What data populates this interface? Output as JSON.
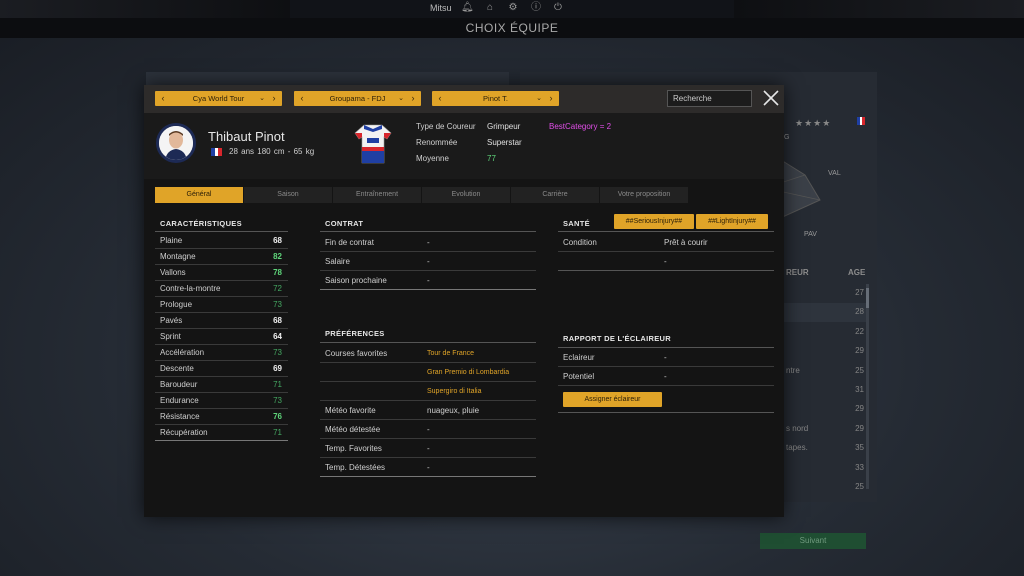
{
  "topbar": {
    "user": "Mitsu",
    "page_title": "CHOIX ÉQUIPE"
  },
  "background": {
    "stars": "★★★★",
    "radar_labels": [
      "G",
      "VAL",
      "PAV"
    ],
    "col_head": "REUR",
    "age_head": "AGE",
    "rows": [
      {
        "txt": "",
        "age": "27"
      },
      {
        "txt": "",
        "age": "28"
      },
      {
        "txt": "",
        "age": "22"
      },
      {
        "txt": "",
        "age": "29"
      },
      {
        "txt": "ntre",
        "age": "25"
      },
      {
        "txt": "",
        "age": "31"
      },
      {
        "txt": "",
        "age": "29"
      },
      {
        "txt": "s nord",
        "age": "29"
      },
      {
        "txt": "tapes.",
        "age": "35"
      },
      {
        "txt": "",
        "age": "33"
      },
      {
        "txt": "",
        "age": "25"
      }
    ],
    "next_button": "Suivant"
  },
  "filters": {
    "competition": "Cya World Tour",
    "team": "Groupama - FDJ",
    "rider": "Pinot T.",
    "search_placeholder": "Recherche"
  },
  "rider": {
    "name": "Thibaut Pinot",
    "info": "28 ans   180 cm - 65 kg",
    "type_label": "Type de Coureur",
    "type_value": "Grimpeur",
    "best_category": "BestCategory = 2",
    "renown_label": "Renommée",
    "renown_value": "Superstar",
    "average_label": "Moyenne",
    "average_value": "77"
  },
  "tabs": [
    "Général",
    "Saison",
    "Entraînement",
    "Evolution",
    "Carrière",
    "Votre proposition"
  ],
  "characteristics": {
    "title": "CARACTÉRISTIQUES",
    "items": [
      {
        "label": "Plaine",
        "value": "68"
      },
      {
        "label": "Montagne",
        "value": "82"
      },
      {
        "label": "Vallons",
        "value": "78"
      },
      {
        "label": "Contre-la-montre",
        "value": "72"
      },
      {
        "label": "Prologue",
        "value": "73"
      },
      {
        "label": "Pavés",
        "value": "68"
      },
      {
        "label": "Sprint",
        "value": "64"
      },
      {
        "label": "Accélération",
        "value": "73"
      },
      {
        "label": "Descente",
        "value": "69"
      },
      {
        "label": "Baroudeur",
        "value": "71"
      },
      {
        "label": "Endurance",
        "value": "73"
      },
      {
        "label": "Résistance",
        "value": "76"
      },
      {
        "label": "Récupération",
        "value": "71"
      }
    ]
  },
  "contract": {
    "title": "CONTRAT",
    "items": [
      {
        "label": "Fin de contrat",
        "value": "-"
      },
      {
        "label": "Salaire",
        "value": "-"
      },
      {
        "label": "Saison prochaine",
        "value": "-"
      }
    ]
  },
  "preferences": {
    "title": "PRÉFÉRENCES",
    "fav_races_label": "Courses favorites",
    "fav_races": [
      "Tour de France",
      "Gran Premio di Lombardia",
      "Supergiro di Italia"
    ],
    "items": [
      {
        "label": "Météo favorite",
        "value": "nuageux, pluie"
      },
      {
        "label": "Météo détestée",
        "value": "-"
      },
      {
        "label": "Temp. Favorites",
        "value": "-"
      },
      {
        "label": "Temp. Détestées",
        "value": "-"
      }
    ]
  },
  "health": {
    "title": "SANTÉ",
    "btn_serious": "##SeriousInjury##",
    "btn_light": "##LightInjury##",
    "condition_label": "Condition",
    "condition_value": "Prêt à courir",
    "extra_value": "-"
  },
  "scout": {
    "title": "RAPPORT DE L'ÉCLAIREUR",
    "items": [
      {
        "label": "Eclaireur",
        "value": "-"
      },
      {
        "label": "Potentiel",
        "value": "-"
      }
    ],
    "assign_button": "Assigner éclaireur"
  },
  "colors": {
    "accent": "#e0a428",
    "green_value": "#5fd67b",
    "magenta": "#e14ee8",
    "flag_blue": "#1f3fa3",
    "flag_red": "#d8262c"
  }
}
